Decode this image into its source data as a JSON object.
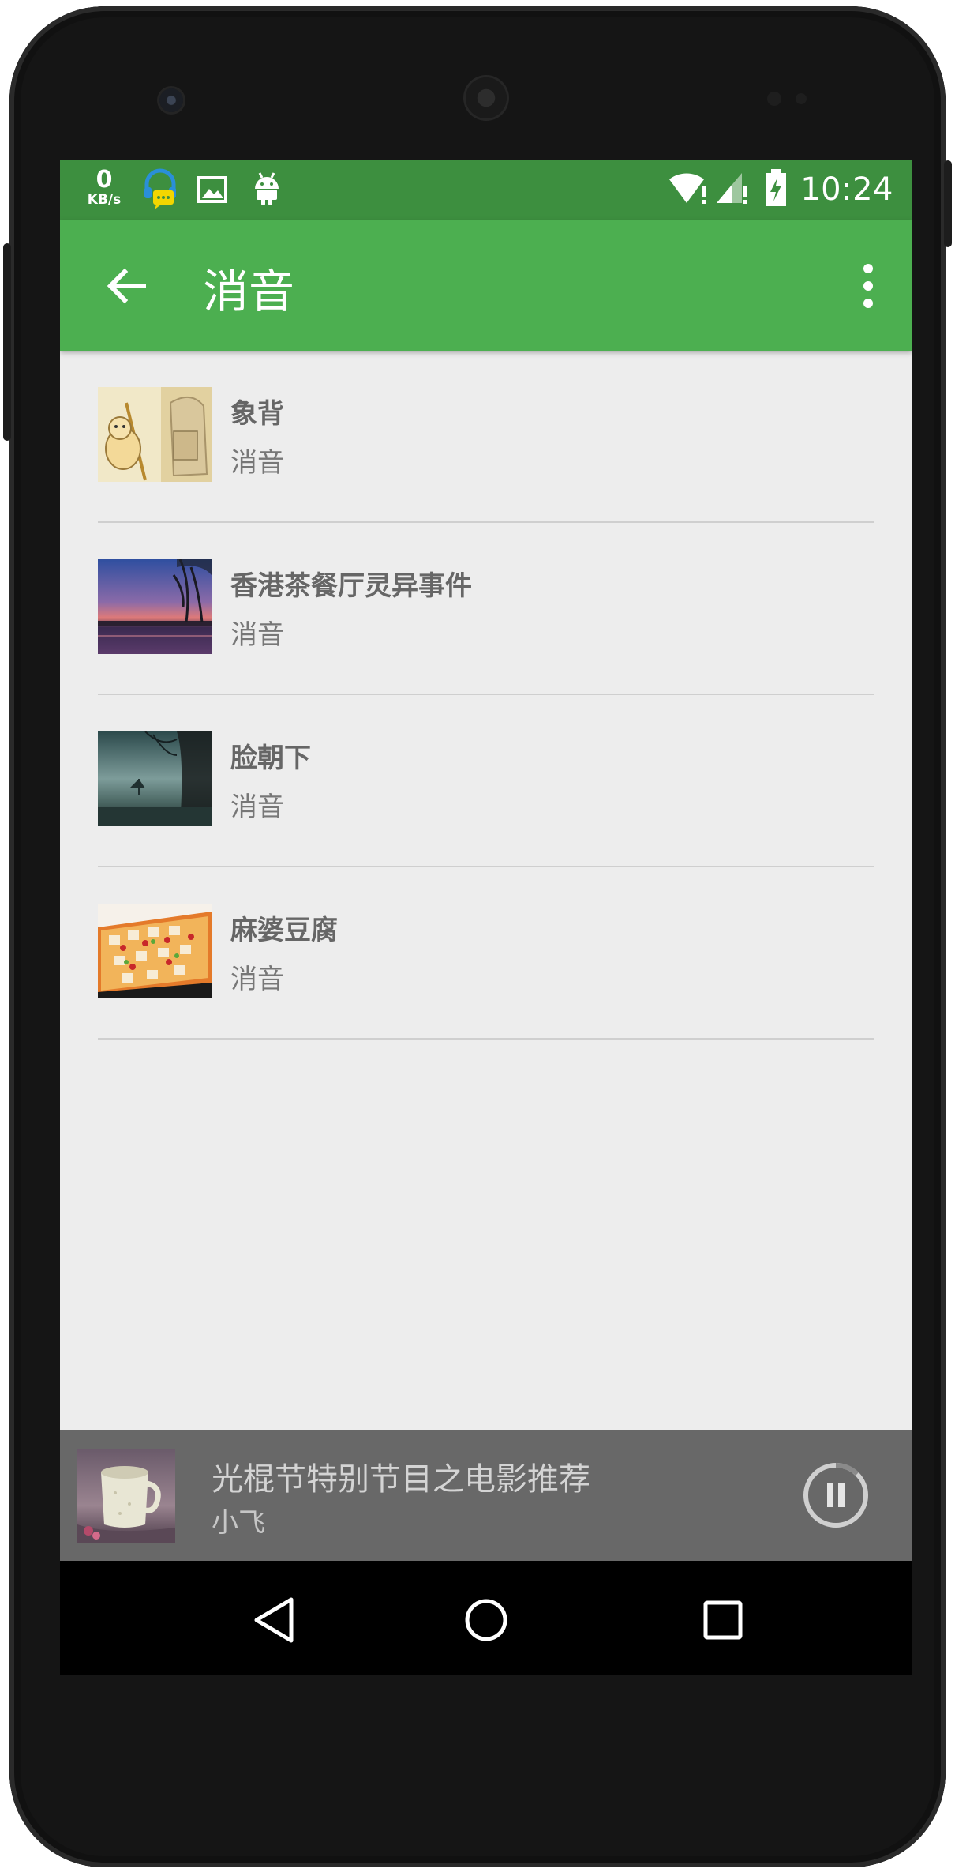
{
  "status_bar": {
    "net_speed_value": "0",
    "net_speed_unit": "KB/s",
    "time": "10:24",
    "icons": [
      "headset-message-icon",
      "image-icon",
      "android-icon",
      "wifi-icon",
      "signal-icon",
      "battery-charging-icon"
    ]
  },
  "app_bar": {
    "title": "消音",
    "back_icon": "arrow-back-icon",
    "menu_icon": "more-vert-icon"
  },
  "list": {
    "items": [
      {
        "title": "象背",
        "subtitle": "消音",
        "thumb": "cartoon-elephant"
      },
      {
        "title": "香港茶餐厅灵异事件",
        "subtitle": "消音",
        "thumb": "sunset-lake"
      },
      {
        "title": "脸朝下",
        "subtitle": "消音",
        "thumb": "dark-tree-sky"
      },
      {
        "title": "麻婆豆腐",
        "subtitle": "消音",
        "thumb": "mapo-tofu"
      }
    ]
  },
  "player": {
    "title": "光棍节特别节目之电影推荐",
    "artist": "小飞",
    "state_icon": "pause-icon"
  },
  "nav_bar": {
    "icons": [
      "back-triangle-icon",
      "home-circle-icon",
      "recents-square-icon"
    ]
  },
  "colors": {
    "status_bar": "#3d8f3f",
    "app_bar": "#4caf50",
    "list_bg": "#ededed",
    "player_bg": "#686868",
    "nav_bar": "#000000"
  }
}
